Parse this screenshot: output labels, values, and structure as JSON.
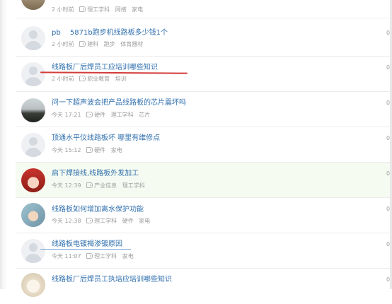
{
  "items": [
    {
      "title": "",
      "time": "2 小时前",
      "tags": [
        "理工学科",
        "网络",
        "家电"
      ],
      "count": "0",
      "avatar": "photo-top"
    },
    {
      "title": "pb　 5871b跑步机线路板多少钱1个",
      "time": "2 小时前",
      "tags": [
        "建科",
        "跑步",
        "体育器材"
      ],
      "count": "0",
      "avatar": "default"
    },
    {
      "title": "线路板厂后焊员工应培训哪些知识",
      "time": "2 小时前",
      "tags": [
        "职业教育",
        "培训"
      ],
      "count": "0",
      "avatar": "default"
    },
    {
      "title": "问一下超声波会把产品线路板的芯片震坏吗",
      "time": "今天 17:21",
      "tags": [
        "硬件",
        "理工学科",
        "芯片"
      ],
      "count": "0",
      "avatar": "photo-sunset"
    },
    {
      "title": "顶通水平仪线路板坏 哪里有维修点",
      "time": "今天 15:12",
      "tags": [
        "硬件",
        "家电"
      ],
      "count": "0",
      "avatar": "default"
    },
    {
      "title": "启下焊接线,线路板外发加工",
      "time": "今天 12:39",
      "tags": [
        "产业信息",
        "理工学科"
      ],
      "count": "0",
      "avatar": "photo-anime"
    },
    {
      "title": "线路板如何增加离水保护功能",
      "time": "今天 12:38",
      "tags": [
        "理工学科",
        "硬件",
        "家电"
      ],
      "count": "0",
      "avatar": "photo-kid"
    },
    {
      "title": "线路板电镀褐渗镀原因",
      "time": "今天 11:07",
      "tags": [
        "理工学科",
        "家电"
      ],
      "count": "0",
      "avatar": "default"
    },
    {
      "title": "线路板厂后焊员工执培应培训哪些知识",
      "time": "",
      "tags": [],
      "count": "0",
      "avatar": "photo-dog"
    }
  ]
}
